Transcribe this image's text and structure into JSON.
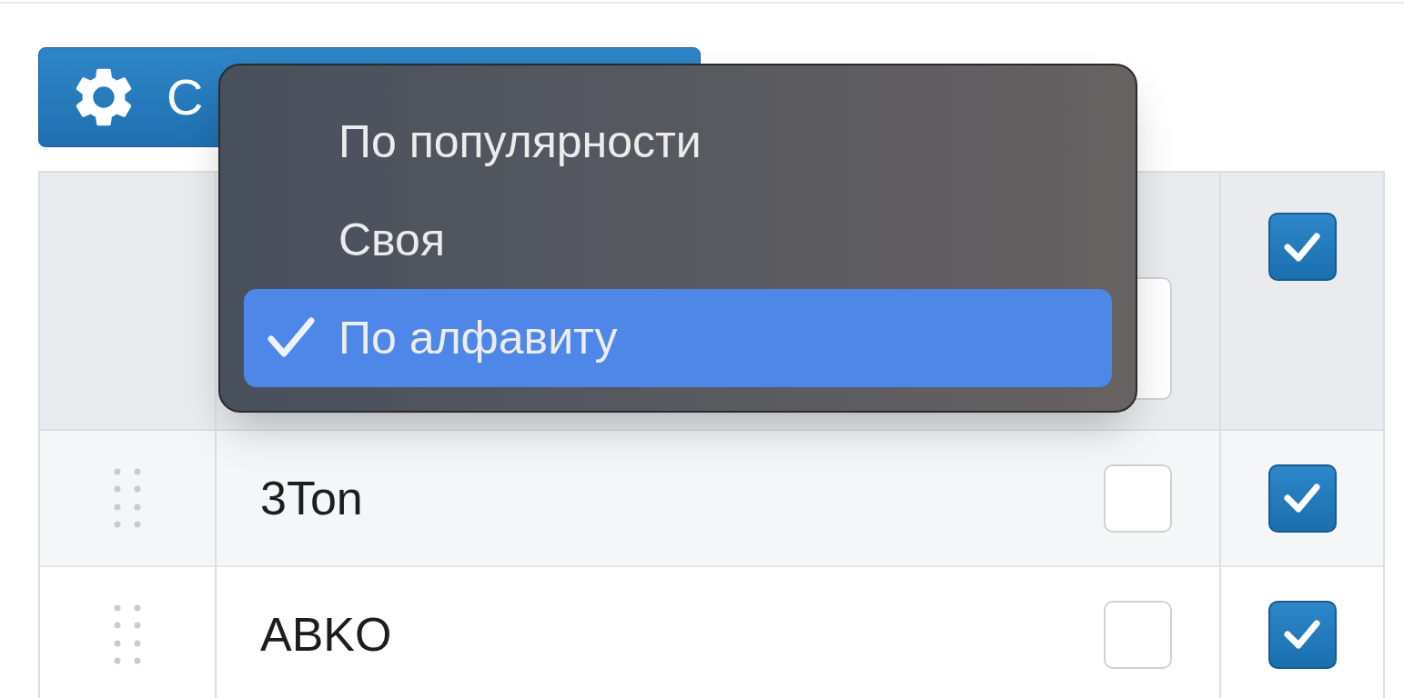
{
  "toolbar": {
    "button": {
      "label": "С"
    }
  },
  "menu": {
    "items": [
      {
        "label": "По популярности",
        "selected": false
      },
      {
        "label": "Своя",
        "selected": false
      },
      {
        "label": "По алфавиту",
        "selected": true
      }
    ]
  },
  "table": {
    "header": {
      "checkbox_2": {
        "checked": false
      },
      "checkbox_3": {
        "checked": true
      }
    },
    "rows": [
      {
        "name": "3Ton",
        "checkbox_2": {
          "checked": false
        },
        "checkbox_3": {
          "checked": true
        }
      },
      {
        "name": "ABKO",
        "checkbox_2": {
          "checked": false
        },
        "checkbox_3": {
          "checked": true
        }
      }
    ]
  }
}
